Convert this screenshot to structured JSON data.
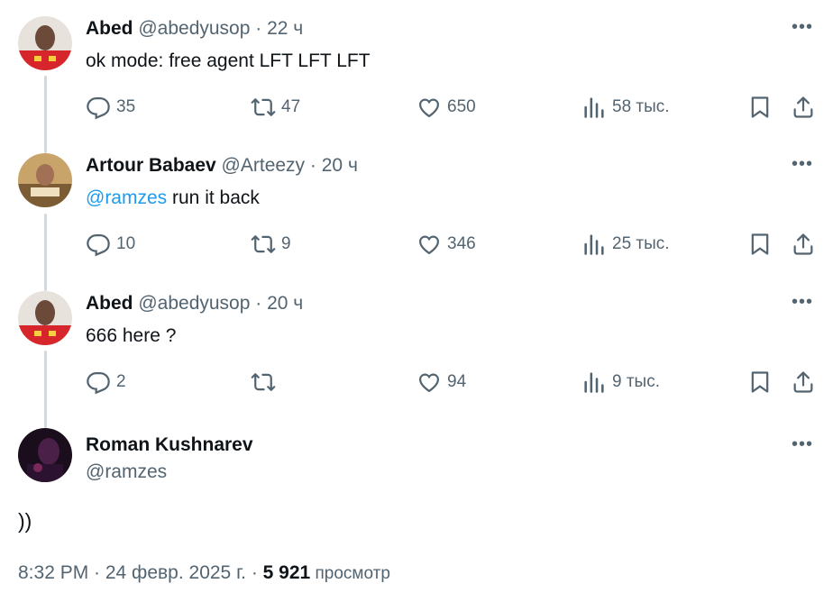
{
  "tweets": [
    {
      "name": "Abed",
      "handle": "@abedyusop",
      "time": "22 ч",
      "text": "ok mode: free agent LFT LFT LFT",
      "mention": "",
      "replies": "35",
      "reposts": "47",
      "likes": "650",
      "views": "58 тыс."
    },
    {
      "name": "Artour Babaev",
      "handle": "@Arteezy",
      "time": "20 ч",
      "mention": "@ramzes",
      "text": " run it back",
      "replies": "10",
      "reposts": "9",
      "likes": "346",
      "views": "25 тыс."
    },
    {
      "name": "Abed",
      "handle": "@abedyusop",
      "time": "20 ч",
      "text": "666 here ?",
      "mention": "",
      "replies": "2",
      "reposts": "",
      "likes": "94",
      "views": "9 тыс."
    }
  ],
  "main": {
    "name": "Roman Kushnarev",
    "handle": "@ramzes",
    "text": "))",
    "timestamp": "8:32 PM · 24 февр. 2025 г. · ",
    "views_count": "5 921",
    "views_label": " просмотр"
  },
  "colors": {
    "text": "#0f1419",
    "secondary": "#536471",
    "link": "#1d9bf0",
    "thread_line": "#cfd9de"
  },
  "icons": [
    "reply-icon",
    "repost-icon",
    "like-icon",
    "views-icon",
    "bookmark-icon",
    "share-icon",
    "more-icon"
  ]
}
